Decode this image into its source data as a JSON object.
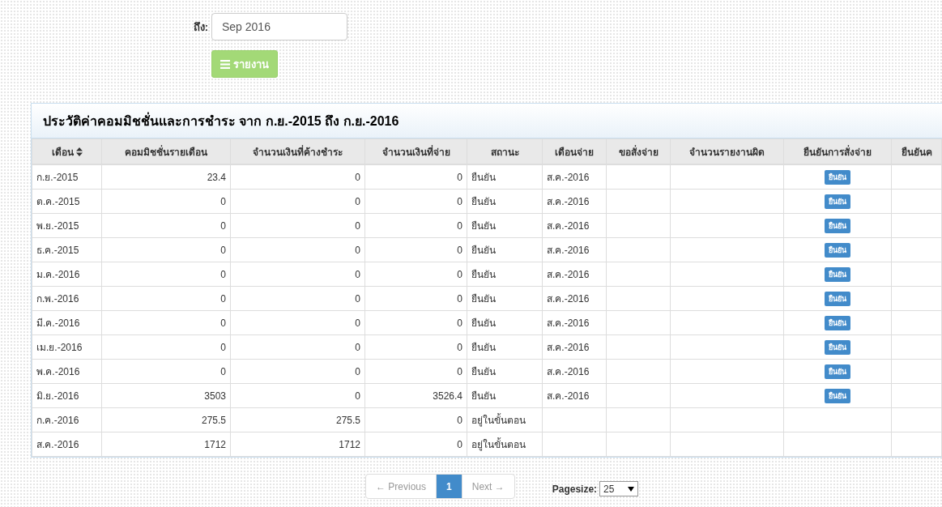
{
  "filter": {
    "to_label": "ถึง:",
    "to_value": "Sep 2016",
    "report_button": "รายงาน"
  },
  "panel": {
    "title": "ประวัติค่าคอมมิชชั่นและการชำระ จาก ก.ย.-2015 ถึง ก.ย.-2016"
  },
  "table": {
    "columns": [
      {
        "label": "เดือน",
        "sortable": true
      },
      {
        "label": "คอมมิชชั่นรายเดือน",
        "sortable": false
      },
      {
        "label": "จำนวนเงินที่ค้างชำระ",
        "sortable": false
      },
      {
        "label": "จำนวนเงินที่จ่าย",
        "sortable": false
      },
      {
        "label": "สถานะ",
        "sortable": false
      },
      {
        "label": "เดือนจ่าย",
        "sortable": false
      },
      {
        "label": "ขอสั่งจ่าย",
        "sortable": false
      },
      {
        "label": "จำนวนรายงานผิด",
        "sortable": false
      },
      {
        "label": "ยืนยันการสั่งจ่าย",
        "sortable": false
      },
      {
        "label": "ยืนยันค",
        "sortable": false
      }
    ],
    "rows": [
      {
        "month": "ก.ย.-2015",
        "commission": "23.4",
        "outstanding": "0",
        "paid": "0",
        "status": "ยืนยัน",
        "pay_month": "ส.ค.-2016",
        "confirm_button": "ยืนยัน"
      },
      {
        "month": "ต.ค.-2015",
        "commission": "0",
        "outstanding": "0",
        "paid": "0",
        "status": "ยืนยัน",
        "pay_month": "ส.ค.-2016",
        "confirm_button": "ยืนยัน"
      },
      {
        "month": "พ.ย.-2015",
        "commission": "0",
        "outstanding": "0",
        "paid": "0",
        "status": "ยืนยัน",
        "pay_month": "ส.ค.-2016",
        "confirm_button": "ยืนยัน"
      },
      {
        "month": "ธ.ค.-2015",
        "commission": "0",
        "outstanding": "0",
        "paid": "0",
        "status": "ยืนยัน",
        "pay_month": "ส.ค.-2016",
        "confirm_button": "ยืนยัน"
      },
      {
        "month": "ม.ค.-2016",
        "commission": "0",
        "outstanding": "0",
        "paid": "0",
        "status": "ยืนยัน",
        "pay_month": "ส.ค.-2016",
        "confirm_button": "ยืนยัน"
      },
      {
        "month": "ก.พ.-2016",
        "commission": "0",
        "outstanding": "0",
        "paid": "0",
        "status": "ยืนยัน",
        "pay_month": "ส.ค.-2016",
        "confirm_button": "ยืนยัน"
      },
      {
        "month": "มี.ค.-2016",
        "commission": "0",
        "outstanding": "0",
        "paid": "0",
        "status": "ยืนยัน",
        "pay_month": "ส.ค.-2016",
        "confirm_button": "ยืนยัน"
      },
      {
        "month": "เม.ย.-2016",
        "commission": "0",
        "outstanding": "0",
        "paid": "0",
        "status": "ยืนยัน",
        "pay_month": "ส.ค.-2016",
        "confirm_button": "ยืนยัน"
      },
      {
        "month": "พ.ค.-2016",
        "commission": "0",
        "outstanding": "0",
        "paid": "0",
        "status": "ยืนยัน",
        "pay_month": "ส.ค.-2016",
        "confirm_button": "ยืนยัน"
      },
      {
        "month": "มิ.ย.-2016",
        "commission": "3503",
        "outstanding": "0",
        "paid": "3526.4",
        "status": "ยืนยัน",
        "pay_month": "ส.ค.-2016",
        "confirm_button": "ยืนยัน"
      },
      {
        "month": "ก.ค.-2016",
        "commission": "275.5",
        "outstanding": "275.5",
        "paid": "0",
        "status": "อยู่ในขั้นตอน"
      },
      {
        "month": "ส.ค.-2016",
        "commission": "1712",
        "outstanding": "1712",
        "paid": "0",
        "status": "อยู่ในขั้นตอน"
      }
    ]
  },
  "pagination": {
    "previous": "← Previous",
    "pages": [
      {
        "label": "1",
        "selected": true
      }
    ],
    "next": "Next →",
    "pagesize_label": "Pagesize:",
    "pagesize_value": "25"
  }
}
